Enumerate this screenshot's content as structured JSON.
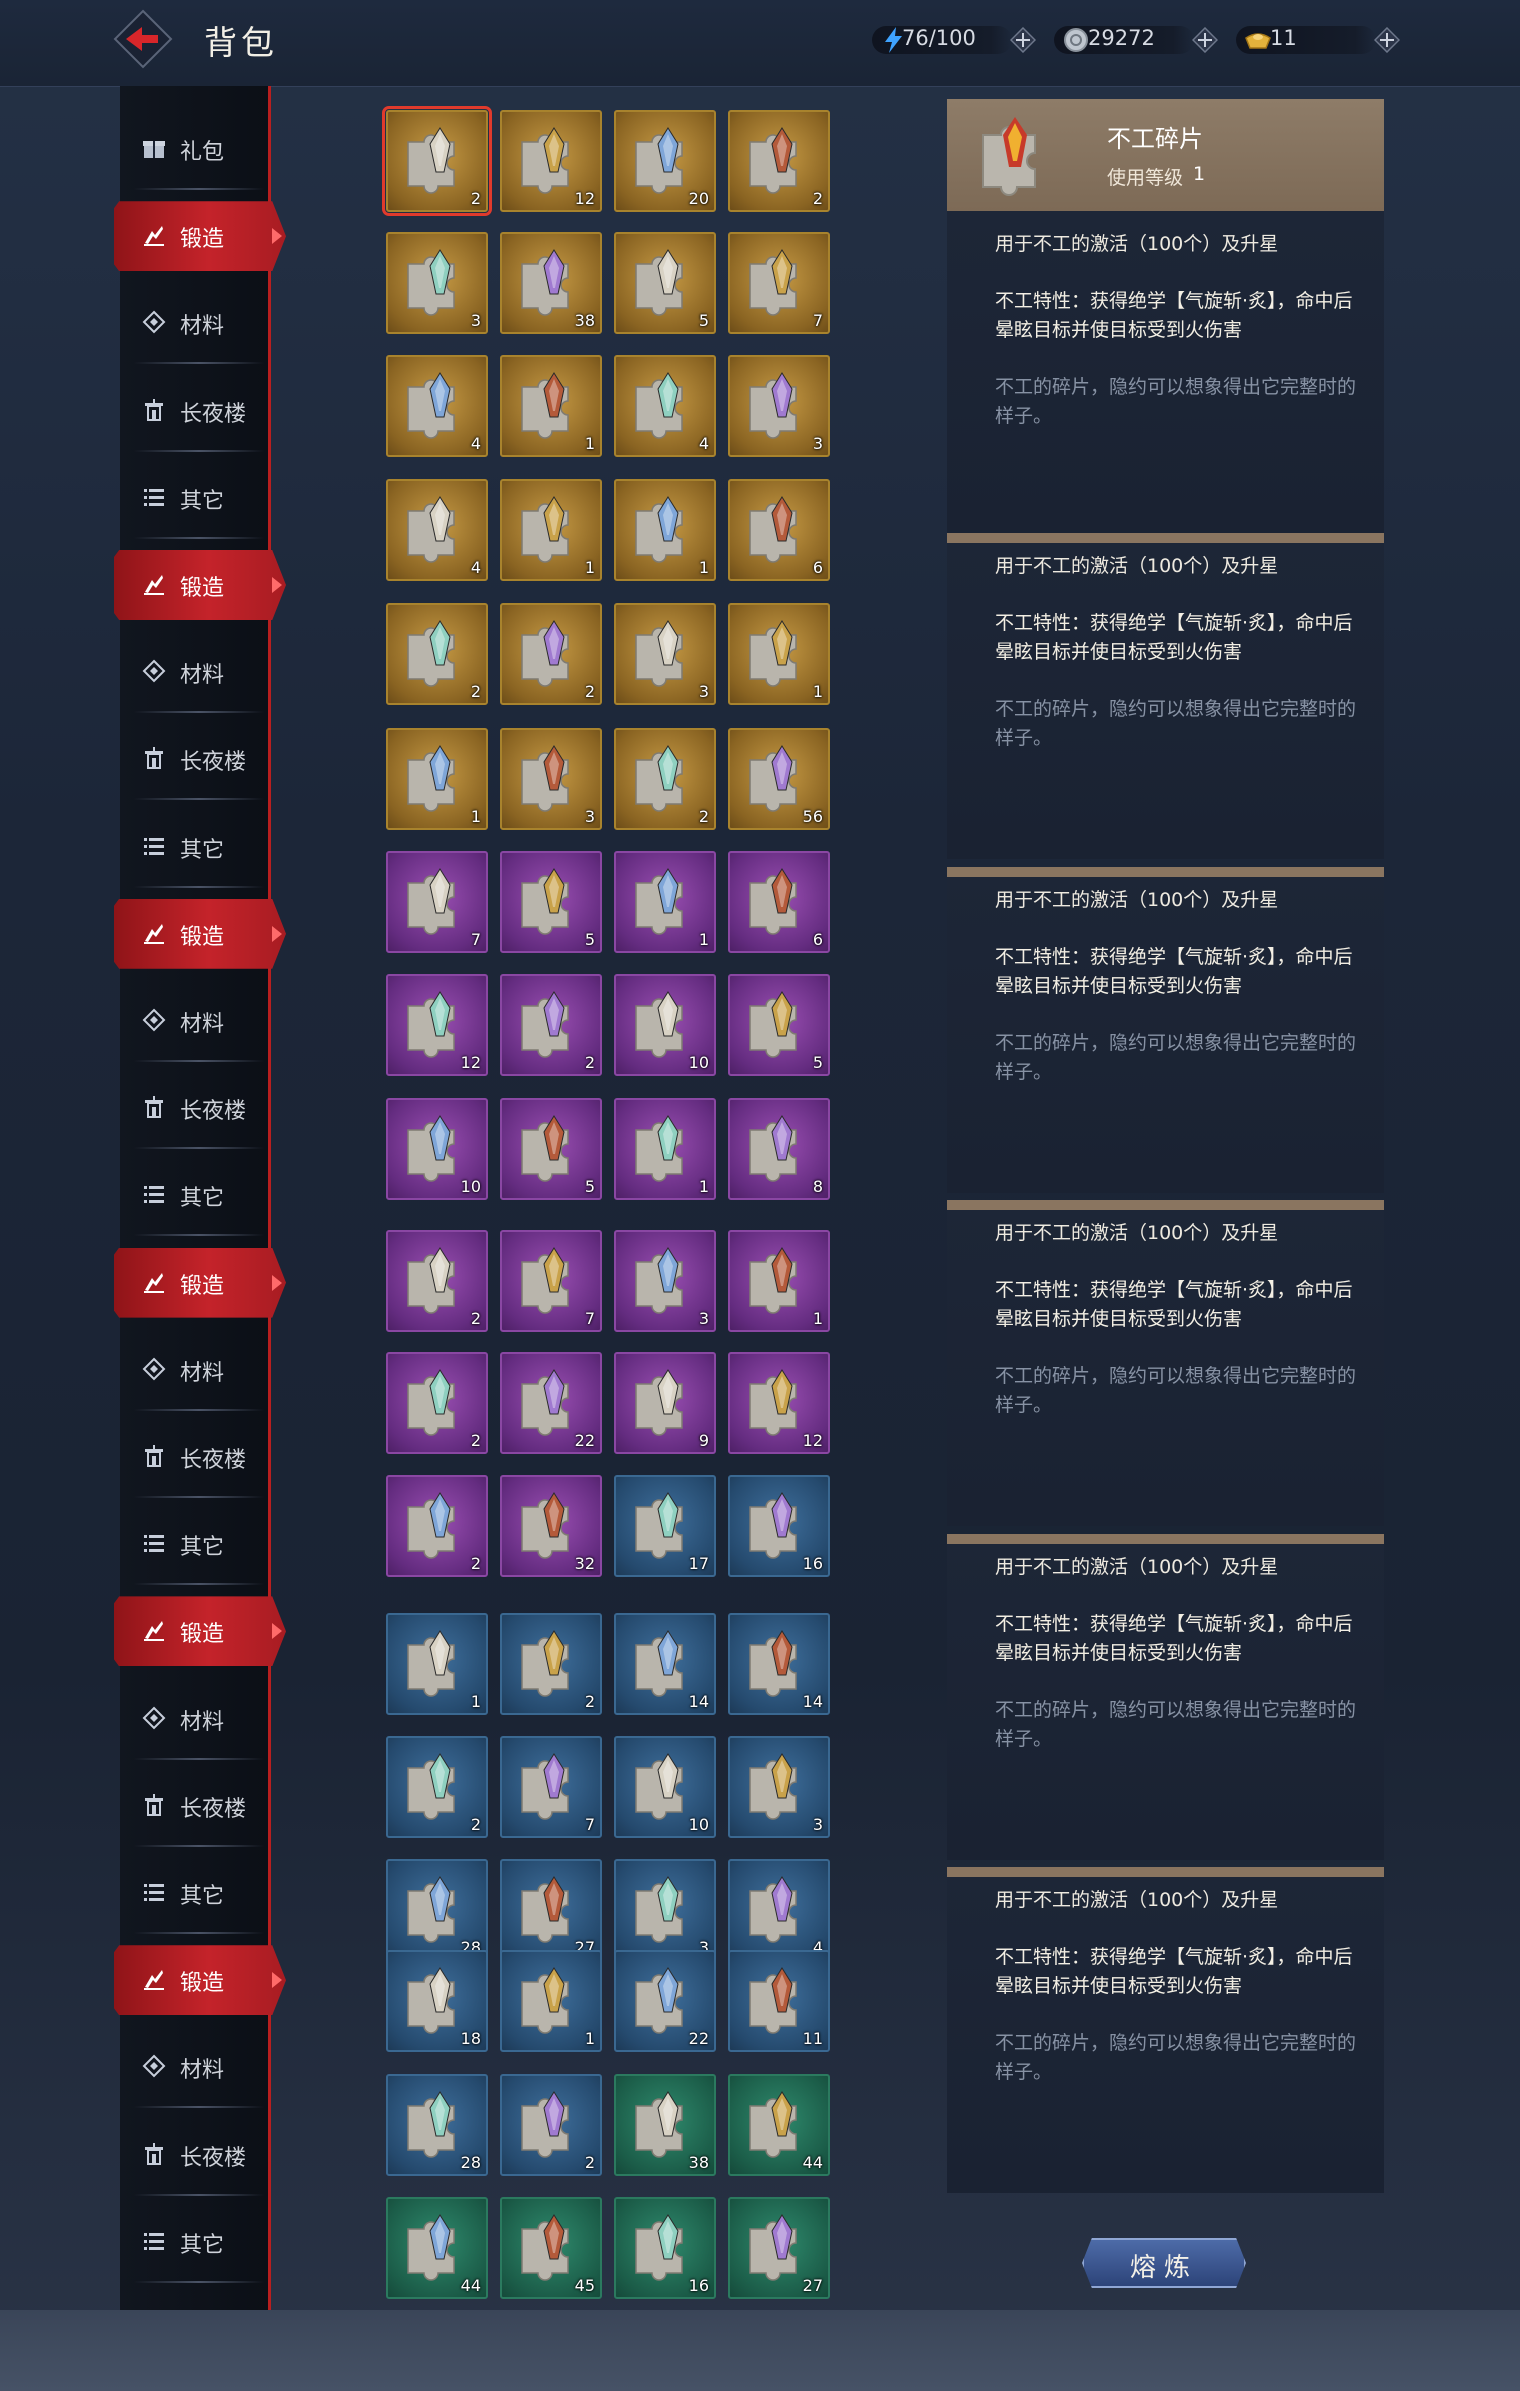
{
  "header": {
    "title": "背包",
    "stamina": "76/100",
    "silver": "29272",
    "gold": "11"
  },
  "sidebar_groups": [
    {
      "labels": [
        "礼包",
        "锻造",
        "材料",
        "长夜楼",
        "其它"
      ]
    },
    {
      "labels": [
        "锻造",
        "材料",
        "长夜楼",
        "其它"
      ]
    },
    {
      "labels": [
        "锻造",
        "材料",
        "长夜楼",
        "其它"
      ]
    },
    {
      "labels": [
        "锻造",
        "材料",
        "长夜楼",
        "其它"
      ]
    },
    {
      "labels": [
        "锻造",
        "材料",
        "长夜楼",
        "其它"
      ]
    },
    {
      "labels": [
        "锻造",
        "材料",
        "长夜楼",
        "其它"
      ]
    }
  ],
  "inventory_rows": [
    {
      "rarity": "gold",
      "counts": [
        "2",
        "12",
        "20",
        "2"
      ]
    },
    {
      "rarity": "gold",
      "counts": [
        "3",
        "38",
        "5",
        "7"
      ]
    },
    {
      "rarity": "gold",
      "counts": [
        "4",
        "1",
        "4",
        "3"
      ]
    },
    {
      "rarity": "gold",
      "counts": [
        "4",
        "1",
        "1",
        "6"
      ]
    },
    {
      "rarity": "gold",
      "counts": [
        "2",
        "2",
        "3",
        "1"
      ]
    },
    {
      "rarity": "gold",
      "counts": [
        "1",
        "3",
        "2",
        "56"
      ]
    },
    {
      "rarity": "purple",
      "counts": [
        "7",
        "5",
        "1",
        "6"
      ]
    },
    {
      "rarity": "purple",
      "counts": [
        "12",
        "2",
        "10",
        "5"
      ]
    },
    {
      "rarity": "purple",
      "counts": [
        "10",
        "5",
        "1",
        "8"
      ]
    },
    {
      "rarity": "purple",
      "counts": [
        "2",
        "7",
        "3",
        "1"
      ]
    },
    {
      "rarity": "purple",
      "counts": [
        "2",
        "22",
        "9",
        "12"
      ]
    },
    {
      "rarity": "mixed",
      "counts": [
        "2",
        "32",
        "17",
        "16"
      ]
    },
    {
      "rarity": "blue",
      "counts": [
        "1",
        "2",
        "14",
        "14"
      ]
    },
    {
      "rarity": "blue",
      "counts": [
        "2",
        "7",
        "10",
        "3"
      ]
    },
    {
      "rarity": "blue",
      "counts": [
        "28",
        "27",
        "3",
        "4"
      ]
    },
    {
      "rarity": "blue",
      "counts": [
        "18",
        "1",
        "22",
        "11"
      ]
    },
    {
      "rarity": "bluegreen",
      "counts": [
        "28",
        "2",
        "38",
        "44"
      ]
    },
    {
      "rarity": "green",
      "counts": [
        "44",
        "45",
        "16",
        "27"
      ]
    }
  ],
  "detail": {
    "name": "不工碎片",
    "level_label": "使用等级",
    "level_value": "1",
    "line1": "用于不工的激活（100个）及升星",
    "line2": "不工特性：获得绝学【气旋斩·炙】，命中后晕眩目标并使目标受到火伤害",
    "line3": "不工的碎片，隐约可以想象得出它完整时的样子。"
  },
  "panel_count": 6,
  "smelt_label": "熔炼",
  "colors": {
    "accent_red": "#c4232a",
    "gold_frame": "#a8832d",
    "purple_frame": "#8a47a3",
    "blue_frame": "#3a6891",
    "green_frame": "#2b7a5f"
  },
  "icons": {
    "back": "back-arrow-icon",
    "stamina": "lightning-icon",
    "silver": "silver-coin-icon",
    "gold": "gold-ingot-icon",
    "category_gift": "gift-icon",
    "category_forge": "forge-icon",
    "category_material": "diamond-icon",
    "category_tower": "tower-icon",
    "category_other": "list-icon"
  }
}
